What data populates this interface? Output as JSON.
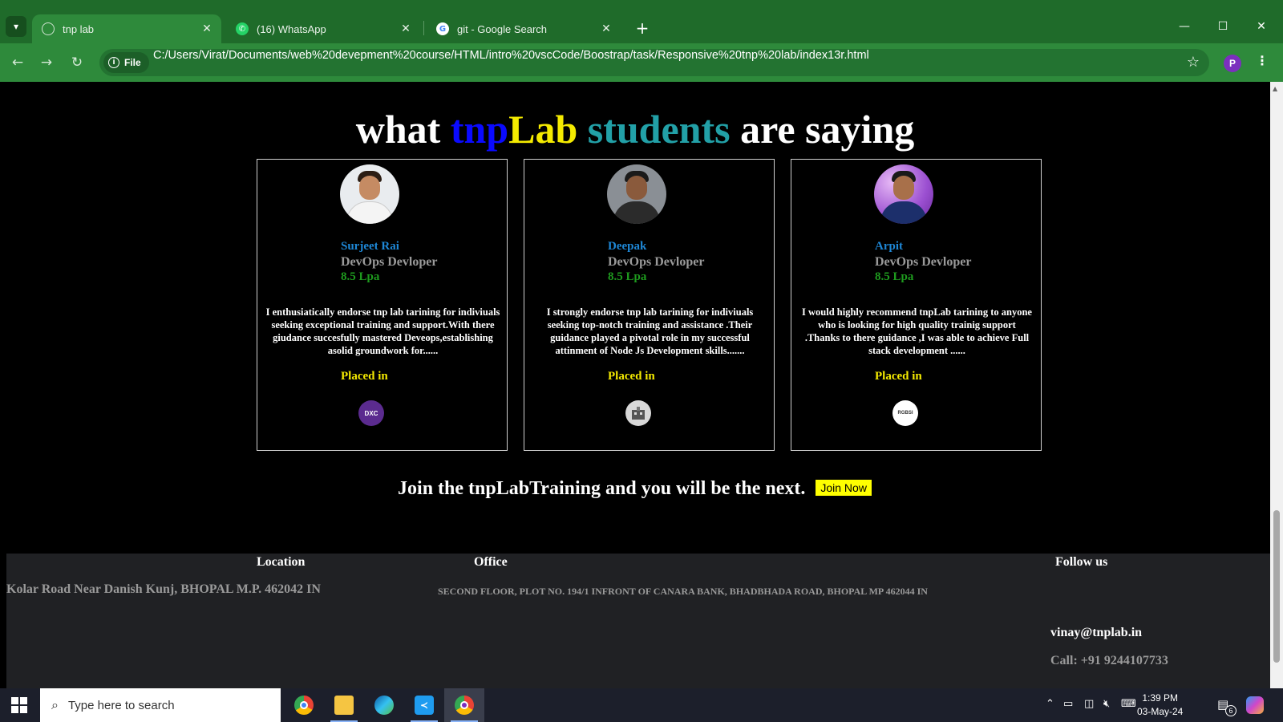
{
  "browser": {
    "tabs": [
      {
        "title": "tnp lab",
        "active": true,
        "favicon": "globe-icon"
      },
      {
        "title": "(16) WhatsApp",
        "active": false,
        "favicon": "whatsapp-icon"
      },
      {
        "title": "git - Google Search",
        "active": false,
        "favicon": "google-icon"
      }
    ],
    "address_chip": "File",
    "url": "C:/Users/Virat/Documents/web%20devepment%20course/HTML/intro%20vscCode/Boostrap/task/Responsive%20tnp%20lab/index13r.html",
    "profile_initial": "P",
    "colors": {
      "frame": "#1f6b2a",
      "toolbar": "#2e8a3b"
    }
  },
  "page": {
    "heading": {
      "w1": "what",
      "w2": "tnp",
      "w3": "Lab",
      "w4": "students",
      "w5": "are saying"
    },
    "testimonials": [
      {
        "name": "Surjeet Rai",
        "role": "DevOps Devloper",
        "package": "8.5 Lpa",
        "quote": "I enthusiatically endorse tnp lab tarining for indiviuals seeking exceptional training and support.With there giudance succesfully mastered Deveops,establishing asolid groundwork for......",
        "placed_label": "Placed in",
        "company_logo_text": "DXC"
      },
      {
        "name": "Deepak",
        "role": "DevOps Devloper",
        "package": "8.5 Lpa",
        "quote": "I strongly endorse tnp lab tarining for indiviuals seeking top-notch training and assistance .Their guidance played a pivotal role in my successful attinment of Node Js Development skills.......",
        "placed_label": "Placed in",
        "company_logo_text": ""
      },
      {
        "name": "Arpit",
        "role": "DevOps Devloper",
        "package": "8.5 Lpa",
        "quote": "I would highly recommend tnpLab tarining to anyone who is looking for high quality trainig support .Thanks to there guidance ,I was able to achieve Full stack development ......",
        "placed_label": "Placed in",
        "company_logo_text": "RGBSI"
      }
    ],
    "cta": {
      "text": "Join the tnpLabTraining and you will be the next.",
      "button": "Join Now"
    },
    "footer": {
      "location_heading": "Location",
      "office_heading": "Office",
      "follow_heading": "Follow us",
      "location": "Kolar Road Near Danish Kunj, BHOPAL M.P. 462042 IN",
      "office": "SECOND FLOOR, PLOT NO. 194/1 INFRONT OF CANARA BANK, BHADBHADA ROAD, BHOPAL MP 462044 IN",
      "email": "vinay@tnplab.in",
      "phone": "Call: +91 9244107733"
    }
  },
  "taskbar": {
    "search_placeholder": "Type here to search",
    "time": "1:39 PM",
    "date": "03-May-24",
    "notification_count": "6"
  }
}
